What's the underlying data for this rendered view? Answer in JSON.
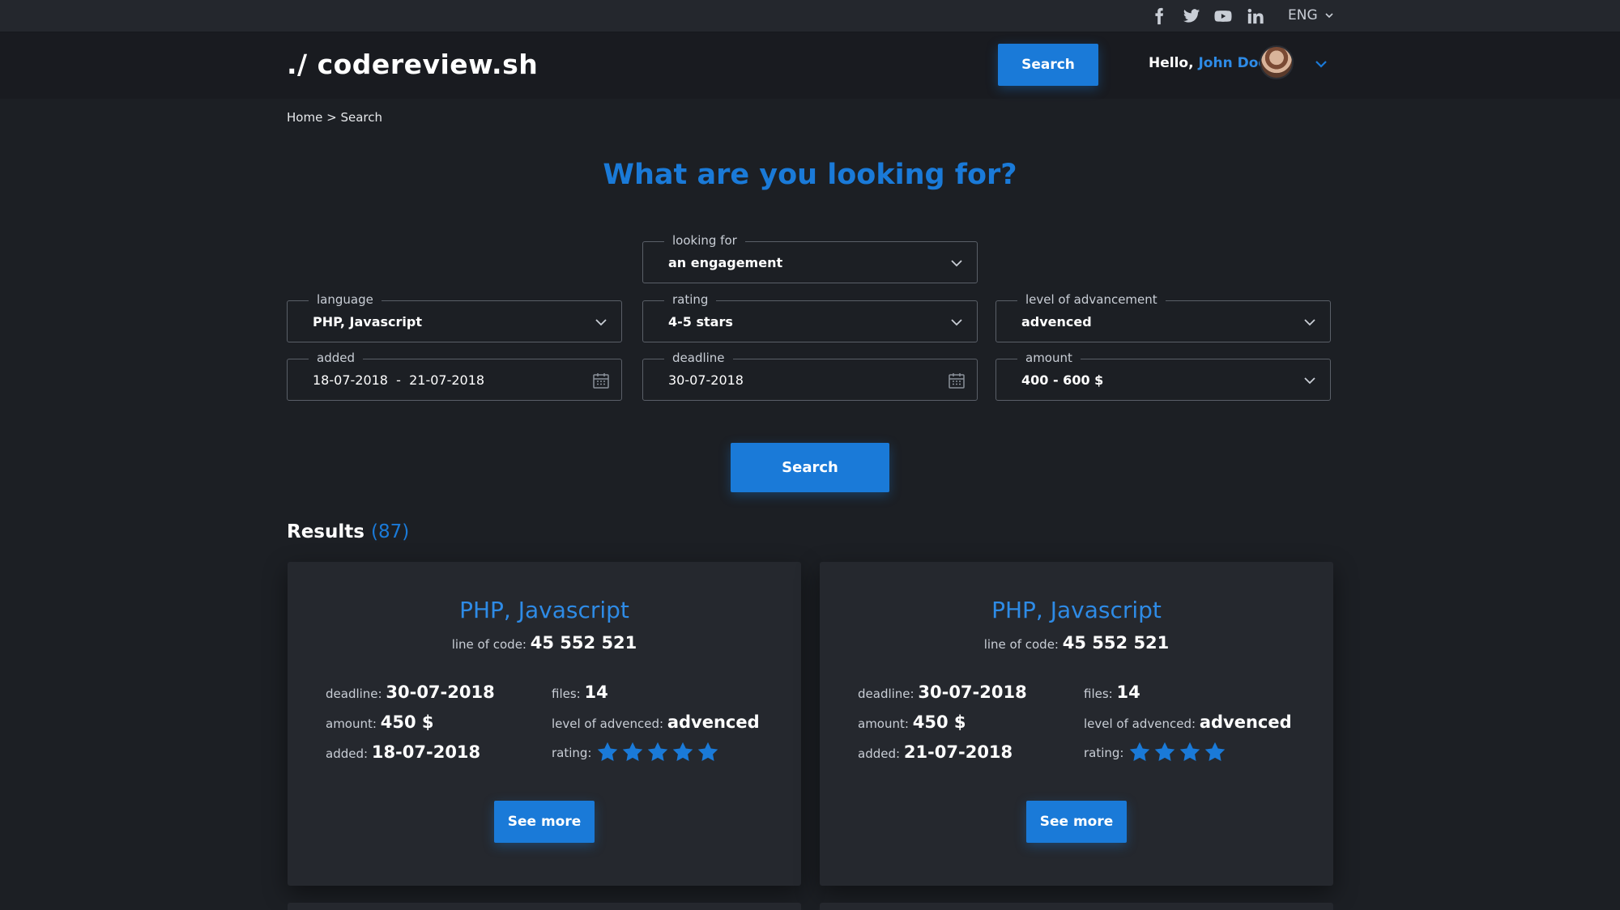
{
  "topbar": {
    "social": [
      "facebook-icon",
      "twitter-icon",
      "youtube-icon",
      "linkedin-icon"
    ],
    "language": "ENG"
  },
  "header": {
    "logo": "./ codereview.sh",
    "search_label": "Search",
    "greeting": "Hello,",
    "username": "John Doe"
  },
  "breadcrumb": {
    "home": "Home",
    "separator": ">",
    "current": "Search"
  },
  "page_title": "What are you looking for?",
  "filters": {
    "looking_for": {
      "label": "looking for",
      "value": "an engagement"
    },
    "language": {
      "label": "language",
      "value": "PHP, Javascript"
    },
    "rating": {
      "label": "rating",
      "value": "4-5 stars"
    },
    "level": {
      "label": "level of advancement",
      "value": "advenced"
    },
    "added": {
      "label": "added",
      "value": "18-07-2018  -  21-07-2018"
    },
    "deadline": {
      "label": "deadline",
      "value": "30-07-2018"
    },
    "amount": {
      "label": "amount",
      "value": "400 - 600 $"
    }
  },
  "search_button": "Search",
  "results": {
    "label": "Results",
    "count": "(87)"
  },
  "labels": {
    "loc": "line of code:",
    "deadline": "deadline:",
    "amount": "amount:",
    "added": "added:",
    "files": "files:",
    "level": "level of advenced:",
    "rating": "rating:",
    "see_more": "See more"
  },
  "cards": [
    {
      "title": "PHP, Javascript",
      "loc": "45 552 521",
      "deadline": "30-07-2018",
      "amount": "450 $",
      "added": "18-07-2018",
      "files": "14",
      "level": "advenced",
      "rating": 5
    },
    {
      "title": "PHP, Javascript",
      "loc": "45 552 521",
      "deadline": "30-07-2018",
      "amount": "450 $",
      "added": "21-07-2018",
      "files": "14",
      "level": "advenced",
      "rating": 4
    }
  ],
  "colors": {
    "accent": "#1a7ad8",
    "background": "#1c1f24",
    "card": "#25282e"
  }
}
